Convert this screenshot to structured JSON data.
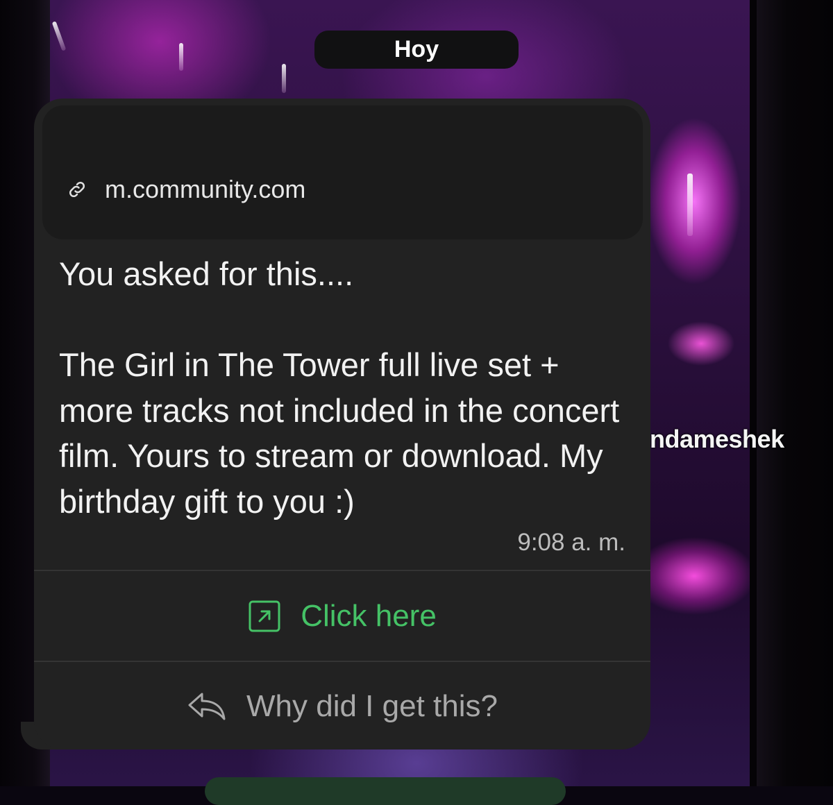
{
  "date_separator": "Hoy",
  "overlay_username": "ndameshek",
  "message": {
    "link_domain": "m.community.com",
    "body": "You asked for this....\n\nThe Girl in The Tower full live set + more tracks not included in the concert film. Yours to stream or download. My birthday gift to you :)",
    "time": "9:08 a. m."
  },
  "actions": {
    "click_here_label": "Click here",
    "why_label": "Why did I get this?"
  },
  "colors": {
    "bubble": "#222222",
    "link_card": "#1b1b1b",
    "accent_green": "#45c266",
    "muted_text": "#a9a9a9"
  },
  "icons": {
    "link": "link-icon",
    "external": "external-link-icon",
    "reply": "reply-arrow-icon"
  }
}
